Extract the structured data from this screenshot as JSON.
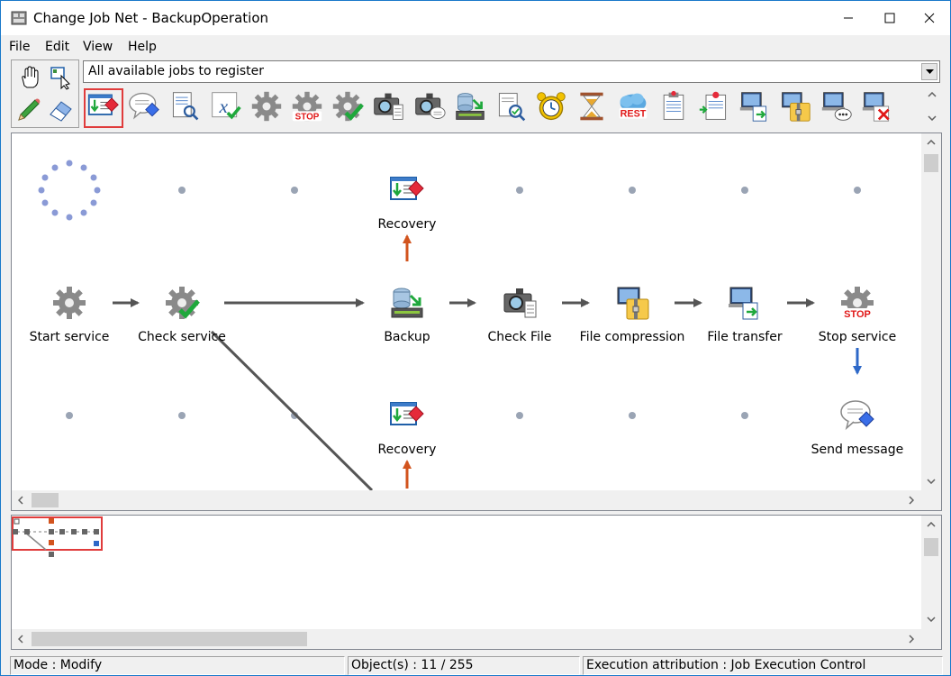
{
  "window": {
    "title": "Change Job Net - BackupOperation",
    "minimize_icon": "minimize-icon",
    "maximize_icon": "maximize-icon",
    "close_icon": "close-icon"
  },
  "menu": [
    {
      "label": "File",
      "key": "F"
    },
    {
      "label": "Edit",
      "key": "E"
    },
    {
      "label": "View",
      "key": "V"
    },
    {
      "label": "Help",
      "key": "H"
    }
  ],
  "tools": {
    "hand_icon": "hand-icon",
    "select_icon": "select-icon",
    "pencil_icon": "pencil-icon",
    "eraser_icon": "eraser-icon"
  },
  "job_filter": {
    "value": "All available jobs to register"
  },
  "palette": [
    "recovery-job-icon",
    "message-job-icon",
    "file-search-icon",
    "variable-check-icon",
    "service-gear-icon",
    "stop-service-icon",
    "check-service-icon",
    "file-check-camera-icon",
    "camera-message-icon",
    "backup-server-icon",
    "file-verify-icon",
    "alarm-clock-icon",
    "hourglass-icon",
    "rest-cloud-icon",
    "clip-document-icon",
    "pin-document-icon",
    "computer-transfer-icon",
    "computer-zip-icon",
    "computer-message-icon",
    "computer-delete-icon"
  ],
  "nodes": [
    {
      "id": "start",
      "label": "Start service",
      "icon": "service-gear-icon"
    },
    {
      "id": "check",
      "label": "Check service",
      "icon": "check-service-icon"
    },
    {
      "id": "backup",
      "label": "Backup",
      "icon": "backup-server-icon"
    },
    {
      "id": "checkfile",
      "label": "Check File",
      "icon": "file-check-camera-icon"
    },
    {
      "id": "compress",
      "label": "File compression",
      "icon": "computer-zip-icon"
    },
    {
      "id": "transfer",
      "label": "File transfer",
      "icon": "computer-transfer-icon"
    },
    {
      "id": "stop",
      "label": "Stop service",
      "icon": "stop-service-icon"
    },
    {
      "id": "recovery1",
      "label": "Recovery",
      "icon": "recovery-job-icon"
    },
    {
      "id": "recovery2",
      "label": "Recovery",
      "icon": "recovery-job-icon"
    },
    {
      "id": "sendmsg",
      "label": "Send message",
      "icon": "message-job-icon"
    }
  ],
  "status": {
    "mode": "Mode : Modify",
    "objects": "Object(s) : 11 / 255",
    "attribution": "Execution attribution : Job Execution Control"
  },
  "colors": {
    "accent": "#1979ca",
    "selection": "#e03c3c",
    "error_arrow": "#d2541e",
    "normal_arrow": "#555555",
    "message_arrow": "#2d68c8"
  }
}
